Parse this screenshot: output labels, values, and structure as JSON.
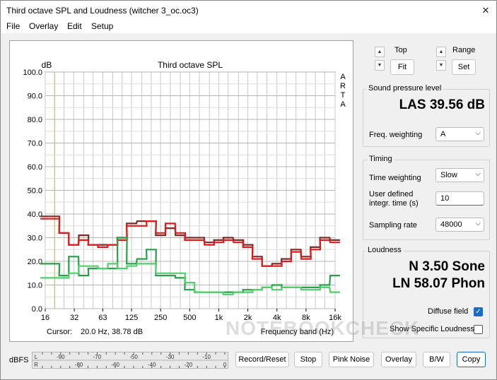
{
  "window": {
    "title": "Third octave SPL and Loudness (witcher 3_oc.oc3)"
  },
  "menu": [
    "File",
    "Overlay",
    "Edit",
    "Setup"
  ],
  "plot": {
    "cursor_label": "Cursor:",
    "cursor_value": "20.0 Hz, 38.78 dB",
    "arta_letters": [
      "A",
      "R",
      "T",
      "A"
    ]
  },
  "chart_data": {
    "type": "line",
    "title": "Third octave SPL",
    "ylabel": "dB",
    "xlabel": "Frequency band (Hz)",
    "ylim": [
      0,
      100
    ],
    "yticks": [
      "0.0",
      "10.0",
      "20.0",
      "30.0",
      "40.0",
      "50.0",
      "60.0",
      "70.0",
      "80.0",
      "90.0",
      "100.0"
    ],
    "xticks": [
      "16",
      "32",
      "63",
      "125",
      "250",
      "500",
      "1k",
      "2k",
      "4k",
      "8k",
      "16k"
    ],
    "x": [
      16,
      20,
      25,
      31.5,
      40,
      50,
      63,
      80,
      100,
      125,
      160,
      200,
      250,
      315,
      400,
      500,
      630,
      800,
      1000,
      1250,
      1600,
      2000,
      2500,
      3150,
      4000,
      5000,
      6300,
      8000,
      10000,
      12500,
      16000
    ],
    "cursor_hz": 20,
    "series": [
      {
        "values": [
          39,
          39,
          32,
          27,
          31,
          27,
          27,
          27,
          30,
          36,
          37,
          37,
          31,
          34,
          31,
          30,
          30,
          28,
          29,
          30,
          29,
          27,
          22,
          18,
          19,
          21,
          25,
          22,
          26,
          30,
          29
        ],
        "color": "#7b2c28"
      },
      {
        "values": [
          38,
          38,
          32,
          27,
          29,
          27,
          26,
          27,
          29,
          35,
          35,
          37,
          32,
          36,
          32,
          29,
          29,
          27,
          28,
          29,
          28,
          26,
          21,
          18,
          18,
          20,
          24,
          21,
          25,
          29,
          28
        ],
        "color": "#e01a1a"
      },
      {
        "values": [
          19,
          19,
          14,
          22,
          14,
          17,
          17,
          17,
          30,
          19,
          21,
          25,
          14,
          14,
          13,
          8,
          7,
          7,
          7,
          7,
          7,
          8,
          8,
          9,
          10,
          9,
          9,
          9,
          9,
          10,
          14
        ],
        "color": "#27a04a"
      },
      {
        "values": [
          13,
          13,
          13,
          15,
          18,
          18,
          17,
          19,
          17,
          18,
          19,
          19,
          15,
          15,
          15,
          11,
          7,
          7,
          7,
          6,
          7,
          7,
          8,
          9,
          8,
          9,
          9,
          8,
          8,
          9,
          7
        ],
        "color": "#4fd06a"
      }
    ]
  },
  "spl_panel": {
    "title": "Sound pressure level",
    "value": "LAS 39.56 dB",
    "freq_weighting_label": "Freq. weighting",
    "freq_weighting_value": "A"
  },
  "top_controls": {
    "top_label": "Top",
    "fit_label": "Fit",
    "range_label": "Range",
    "set_label": "Set"
  },
  "timing": {
    "title": "Timing",
    "time_weighting_label": "Time weighting",
    "time_weighting_value": "Slow",
    "user_defined_label_1": "User defined",
    "user_defined_label_2": "integr. time (s)",
    "user_defined_value": "10",
    "sampling_rate_label": "Sampling rate",
    "sampling_rate_value": "48000"
  },
  "loudness": {
    "title": "Loudness",
    "sone": "N 3.50 Sone",
    "phon": "LN 58.07 Phon",
    "diffuse_field_label": "Diffuse field",
    "diffuse_field_checked": true,
    "show_specific_label": "Show Specific Loudness",
    "show_specific_checked": false
  },
  "meter": {
    "label": "dBFS",
    "row_l": "L",
    "row_r": "R",
    "top_ticks": [
      "-90",
      "-70",
      "-50",
      "-30",
      "-10"
    ],
    "bottom_ticks": [
      "-80",
      "-60",
      "-40",
      "-20",
      "0"
    ]
  },
  "buttons": {
    "record": "Record/Reset",
    "stop": "Stop",
    "pink": "Pink Noise",
    "overlay": "Overlay",
    "bw": "B/W",
    "copy": "Copy"
  },
  "watermark": "NOTEBOOKCHECK"
}
